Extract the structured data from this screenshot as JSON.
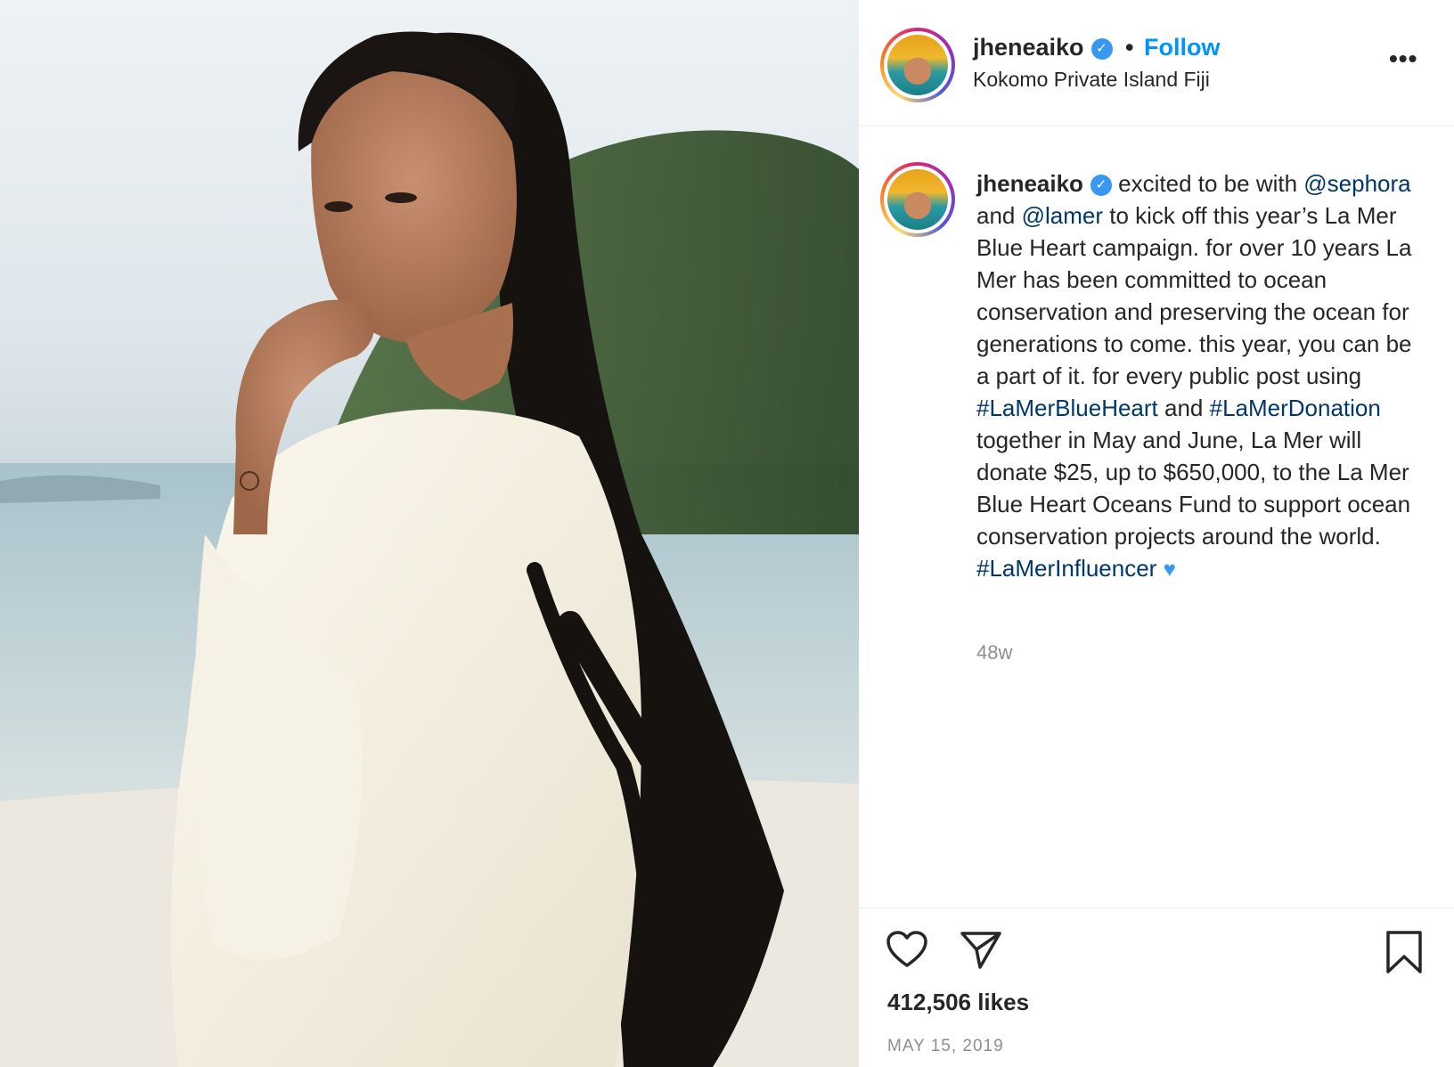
{
  "post": {
    "photo_alt": "Woman with long braids in a white linen dress on a beach",
    "author": {
      "username": "jheneaiko",
      "verified_glyph": "✓",
      "follow_label": "Follow",
      "separator": "•",
      "location": "Kokomo Private Island Fiji"
    },
    "more_label": "•••",
    "caption": {
      "username": "jheneaiko",
      "text_1": " excited to be with ",
      "mention_1": "@sephora",
      "text_2": " and ",
      "mention_2": "@lamer",
      "text_3": " to kick off this year’s La Mer Blue Heart campaign. for over 10 years La Mer has been committed to ocean conservation and preserving the ocean for generations to come. this year, you can be a part of it. for every public post using ",
      "hashtag_1": "#LaMerBlueHeart",
      "text_4": " and ",
      "hashtag_2": "#LaMerDonation",
      "text_5": " together in May and June, La Mer will donate $25, up to $650,000, to the La Mer Blue Heart Oceans Fund to support ocean conservation projects around the world. ",
      "hashtag_3": "#LaMerInfluencer",
      "emoji": "♥"
    },
    "age": "48w",
    "likes": "412,506 likes",
    "date": "MAY 15, 2019"
  },
  "icons": {
    "like": "heart-icon",
    "share": "paper-plane-icon",
    "save": "bookmark-icon",
    "more": "more-options-icon",
    "verified": "verified-badge-icon"
  },
  "colors": {
    "follow": "#0095f6",
    "link": "#00376b",
    "verified": "#3897f0",
    "muted": "#8e8e8e",
    "text": "#262626"
  }
}
